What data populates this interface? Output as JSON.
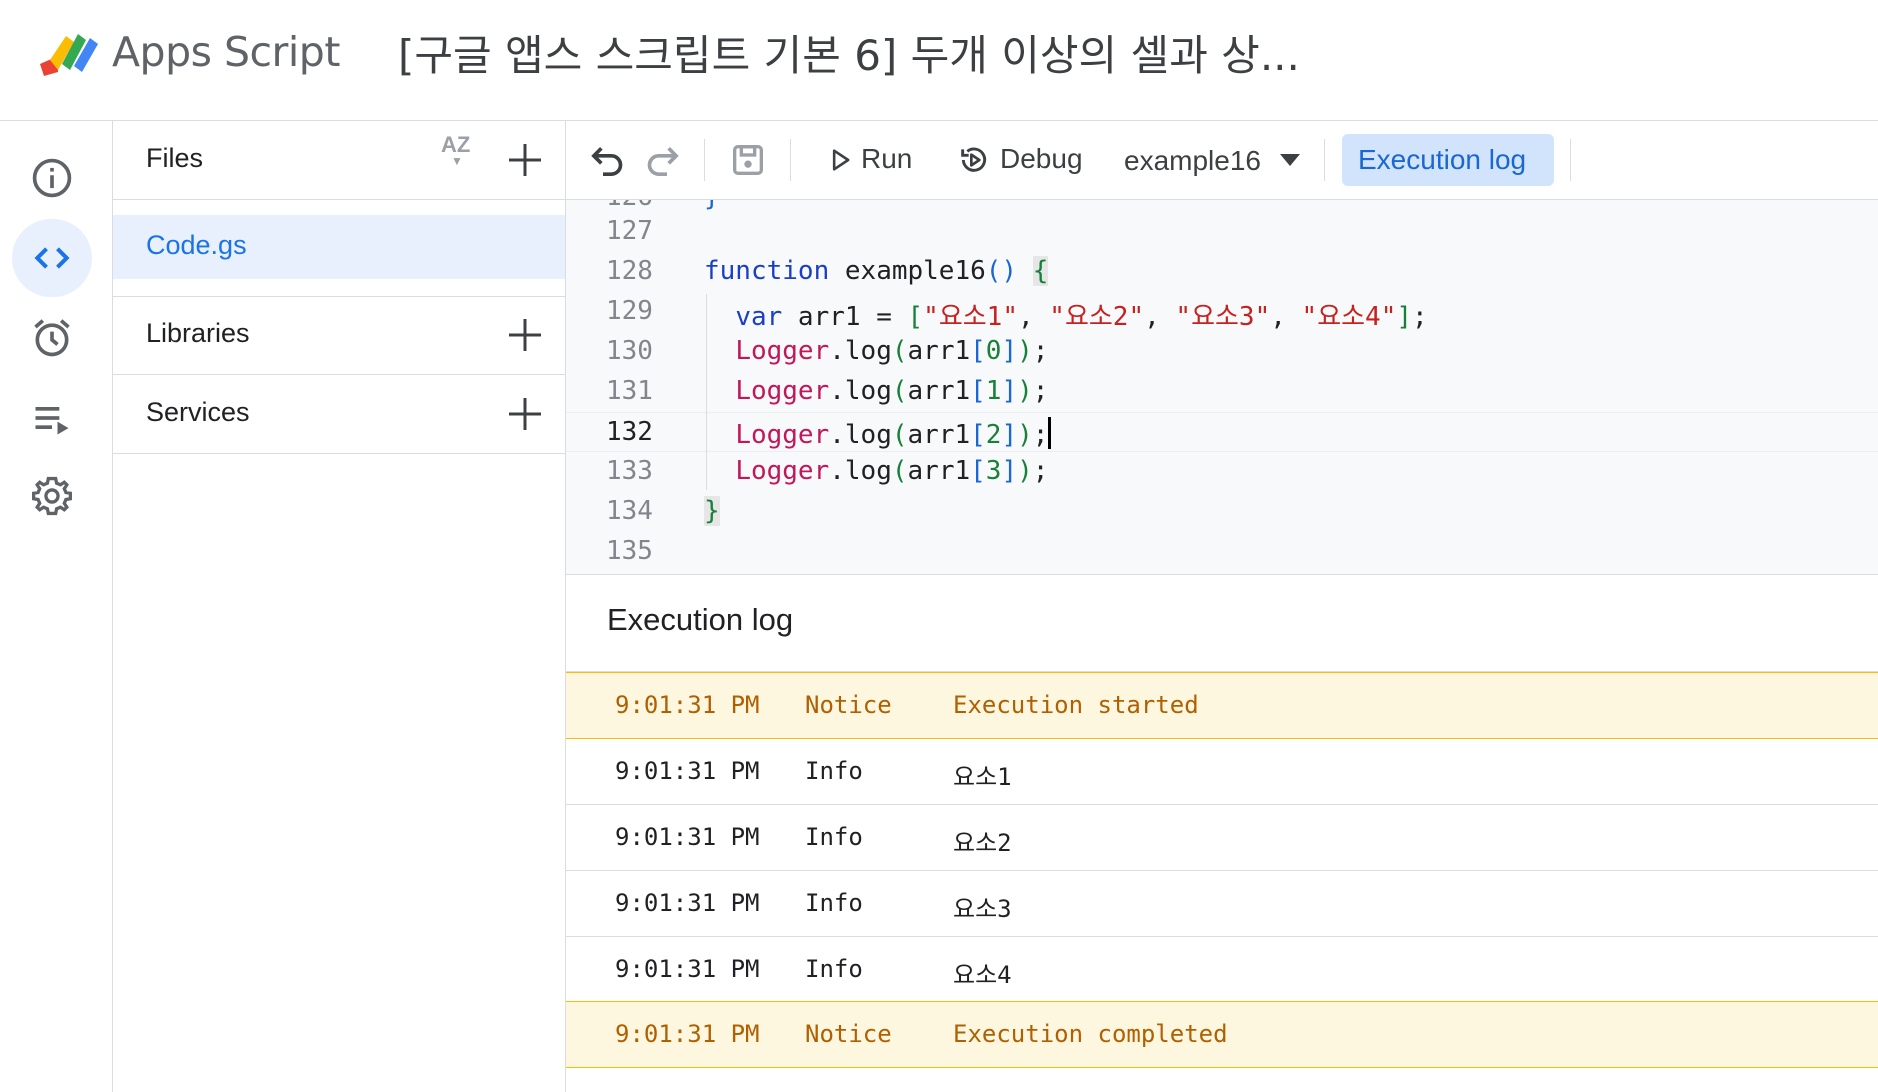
{
  "header": {
    "app_name": "Apps Script",
    "project_title": "[구글 앱스 스크립트 기본 6] 두개 이상의 셀과 상..."
  },
  "rail": {
    "items": [
      {
        "icon": "info-icon"
      },
      {
        "icon": "code-icon",
        "active": true
      },
      {
        "icon": "alarm-clock-icon"
      },
      {
        "icon": "executions-list-icon"
      },
      {
        "icon": "gear-icon"
      }
    ]
  },
  "files_panel": {
    "files_label": "Files",
    "sort_label": "AZ",
    "files": [
      "Code.gs"
    ],
    "libraries_label": "Libraries",
    "services_label": "Services"
  },
  "toolbar": {
    "run_label": "Run",
    "debug_label": "Debug",
    "function_select": "example16",
    "execution_log_label": "Execution log"
  },
  "editor": {
    "current_line": "132",
    "lines": [
      {
        "n": "127",
        "code": ""
      },
      {
        "n": "128",
        "code": "function example16() {"
      },
      {
        "n": "129",
        "code": "  var arr1 = [\"요소1\", \"요소2\", \"요소3\", \"요소4\"];"
      },
      {
        "n": "130",
        "code": "  Logger.log(arr1[0]);"
      },
      {
        "n": "131",
        "code": "  Logger.log(arr1[1]);"
      },
      {
        "n": "132",
        "code": "  Logger.log(arr1[2]);"
      },
      {
        "n": "133",
        "code": "  Logger.log(arr1[3]);"
      },
      {
        "n": "134",
        "code": "}"
      },
      {
        "n": "135",
        "code": ""
      }
    ]
  },
  "execution_log": {
    "title": "Execution log",
    "rows": [
      {
        "time": "9:01:31 PM",
        "level": "Notice",
        "message": "Execution started"
      },
      {
        "time": "9:01:31 PM",
        "level": "Info",
        "message": "요소1"
      },
      {
        "time": "9:01:31 PM",
        "level": "Info",
        "message": "요소2"
      },
      {
        "time": "9:01:31 PM",
        "level": "Info",
        "message": "요소3"
      },
      {
        "time": "9:01:31 PM",
        "level": "Info",
        "message": "요소4"
      },
      {
        "time": "9:01:31 PM",
        "level": "Notice",
        "message": "Execution completed"
      }
    ]
  },
  "colors": {
    "accent": "#1a73e8",
    "notice_bg": "#fef7e0",
    "notice_text": "#b06000"
  }
}
